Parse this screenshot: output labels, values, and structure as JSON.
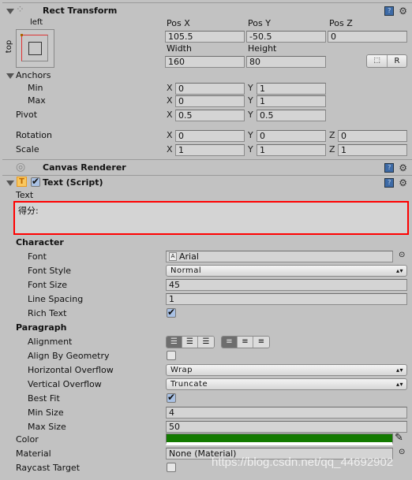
{
  "rect_transform": {
    "title": "Rect Transform",
    "anchor_h": "left",
    "anchor_v": "top",
    "pos_x_label": "Pos X",
    "pos_y_label": "Pos Y",
    "pos_z_label": "Pos Z",
    "pos_x": "105.5",
    "pos_y": "-50.5",
    "pos_z": "0",
    "width_label": "Width",
    "height_label": "Height",
    "width": "160",
    "height": "80",
    "raw_button": "R",
    "anchors_label": "Anchors",
    "min_label": "Min",
    "max_label": "Max",
    "pivot_label": "Pivot",
    "rotation_label": "Rotation",
    "scale_label": "Scale",
    "x": "X",
    "y": "Y",
    "z": "Z",
    "min_x": "0",
    "min_y": "1",
    "max_x": "0",
    "max_y": "1",
    "pivot_x": "0.5",
    "pivot_y": "0.5",
    "rot_x": "0",
    "rot_y": "0",
    "rot_z": "0",
    "scale_x": "1",
    "scale_y": "1",
    "scale_z": "1"
  },
  "canvas_renderer": {
    "title": "Canvas Renderer"
  },
  "text_script": {
    "title": "Text (Script)",
    "enabled": true,
    "text_label": "Text",
    "text_value": "得分:",
    "character": "Character",
    "font_label": "Font",
    "font": "Arial",
    "font_style_label": "Font Style",
    "font_style": "Normal",
    "font_size_label": "Font Size",
    "font_size": "45",
    "line_spacing_label": "Line Spacing",
    "line_spacing": "1",
    "rich_text_label": "Rich Text",
    "rich_text": true,
    "paragraph": "Paragraph",
    "alignment_label": "Alignment",
    "align_by_geometry_label": "Align By Geometry",
    "align_by_geometry": false,
    "h_overflow_label": "Horizontal Overflow",
    "h_overflow": "Wrap",
    "v_overflow_label": "Vertical Overflow",
    "v_overflow": "Truncate",
    "best_fit_label": "Best Fit",
    "best_fit": true,
    "min_size_label": "Min Size",
    "min_size": "4",
    "max_size_label": "Max Size",
    "max_size": "50",
    "color_label": "Color",
    "color": "#137a00",
    "material_label": "Material",
    "material": "None (Material)",
    "raycast_label": "Raycast Target",
    "raycast": false
  },
  "watermark": "https://blog.csdn.net/qq_44692902",
  "colors": {
    "highlight": "#ff0000",
    "panel": "#c2c2c2"
  }
}
